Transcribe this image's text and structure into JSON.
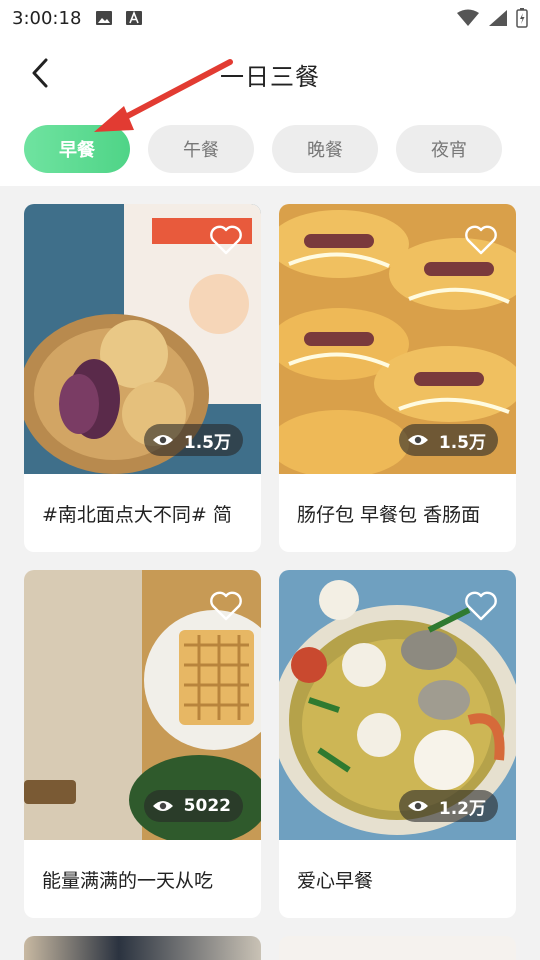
{
  "status": {
    "time": "3:00:18"
  },
  "header": {
    "title": "一日三餐"
  },
  "tabs": [
    {
      "label": "早餐",
      "active": true
    },
    {
      "label": "午餐",
      "active": false
    },
    {
      "label": "晚餐",
      "active": false
    },
    {
      "label": "夜宵",
      "active": false
    }
  ],
  "cards": [
    {
      "views": "1.5万",
      "caption": "#南北面点大不同# 简"
    },
    {
      "views": "1.5万",
      "caption": "肠仔包 早餐包 香肠面"
    },
    {
      "views": "5022",
      "caption": "能量满满的一天从吃"
    },
    {
      "views": "1.2万",
      "caption": "爱心早餐"
    }
  ],
  "colors": {
    "accent": "#4fd487",
    "annotation_arrow": "#e23b32"
  }
}
